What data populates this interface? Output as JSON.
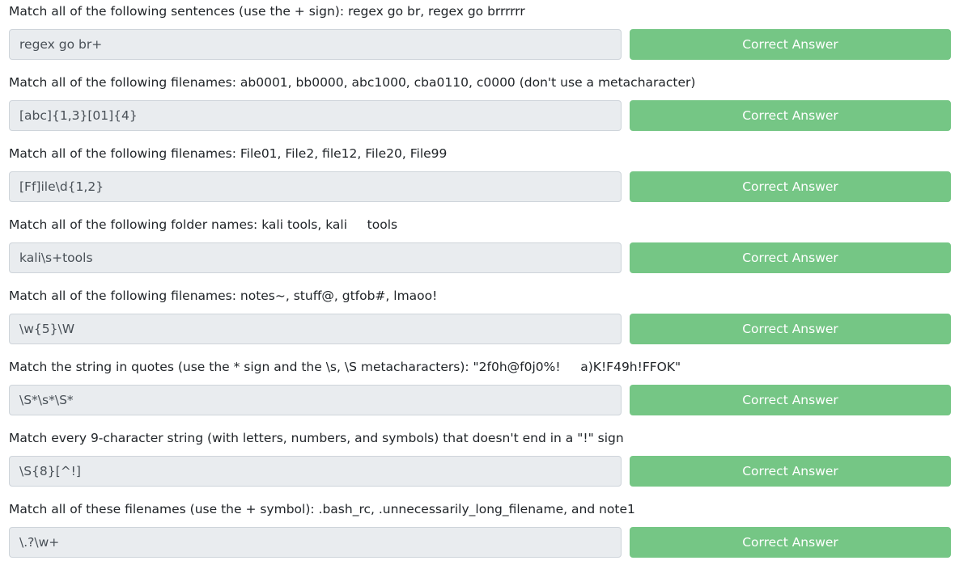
{
  "button_color": "#75c685",
  "questions": [
    {
      "prompt": "Match all of the following sentences (use the + sign): regex go br, regex go brrrrrr",
      "answer": "regex go br+",
      "button": "Correct Answer"
    },
    {
      "prompt": "Match all of the following filenames: ab0001, bb0000, abc1000, cba0110, c0000 (don't use a metacharacter)",
      "answer": "[abc]{1,3}[01]{4}",
      "button": "Correct Answer"
    },
    {
      "prompt": "Match all of the following filenames: File01, File2, file12, File20, File99",
      "answer": "[Ff]ile\\d{1,2}",
      "button": "Correct Answer"
    },
    {
      "prompt": "Match all of the following folder names: kali tools, kali     tools",
      "answer": "kali\\s+tools",
      "button": "Correct Answer"
    },
    {
      "prompt": "Match all of the following filenames: notes~, stuff@, gtfob#, lmaoo!",
      "answer": "\\w{5}\\W",
      "button": "Correct Answer"
    },
    {
      "prompt": "Match the string in quotes (use the * sign and the \\s, \\S metacharacters): \"2f0h@f0j0%!     a)K!F49h!FFOK\"",
      "answer": "\\S*\\s*\\S*",
      "button": "Correct Answer"
    },
    {
      "prompt": "Match every 9-character string (with letters, numbers, and symbols) that doesn't end in a \"!\" sign",
      "answer": "\\S{8}[^!]",
      "button": "Correct Answer"
    },
    {
      "prompt": "Match all of these filenames (use the + symbol): .bash_rc, .unnecessarily_long_filename, and note1",
      "answer": "\\.?\\w+",
      "button": "Correct Answer"
    }
  ]
}
